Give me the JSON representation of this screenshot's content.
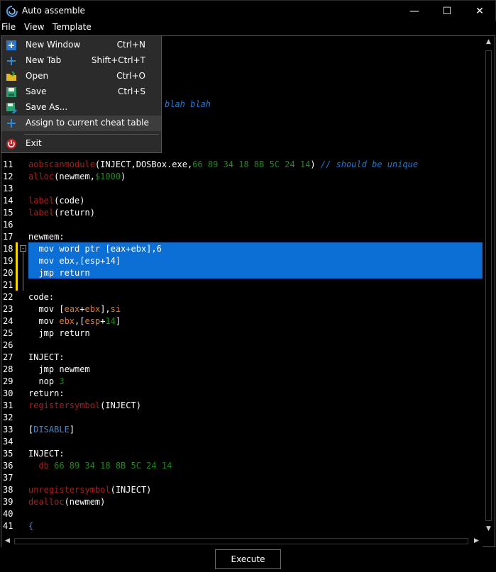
{
  "window": {
    "title": "Auto assemble",
    "min_glyph": "—",
    "max_glyph": "☐",
    "close_glyph": "✕"
  },
  "menubar": {
    "file": "File",
    "view": "View",
    "template": "Template"
  },
  "file_menu": {
    "new_window": {
      "label": "New Window",
      "shortcut": "Ctrl+N"
    },
    "new_tab": {
      "label": "New Tab",
      "shortcut": "Shift+Ctrl+T"
    },
    "open": {
      "label": "Open",
      "shortcut": "Ctrl+O"
    },
    "save": {
      "label": "Save",
      "shortcut": "Ctrl+S"
    },
    "save_as": {
      "label": "Save As..."
    },
    "assign": {
      "label": "Assign to current cheat table"
    },
    "exit": {
      "label": "Exit"
    }
  },
  "editor": {
    "partial_comment": "blah blah",
    "line_numbers": [
      "11",
      "12",
      "13",
      "14",
      "15",
      "16",
      "17",
      "18",
      "19",
      "20",
      "21",
      "22",
      "23",
      "24",
      "25",
      "26",
      "27",
      "28",
      "29",
      "30",
      "31",
      "32",
      "33",
      "34",
      "35",
      "36",
      "37",
      "38",
      "39",
      "40",
      "41"
    ],
    "code": {
      "l11_fn": "aobscanmodule",
      "l11_args_a": "(INJECT,DOSBox.exe,",
      "l11_bytes": "66 89 34 18 8B 5C 24 14",
      "l11_close": ")",
      "l11_comment": "// should be unique",
      "l12_fn": "alloc",
      "l12_args_a": "(newmem,",
      "l12_num": "$1000",
      "l12_close": ")",
      "l14_fn": "label",
      "l14_args": "(code)",
      "l15_fn": "label",
      "l15_args": "(return)",
      "l17": "newmem:",
      "l18": "  mov word ptr [eax+ebx],6",
      "l19": "  mov ebx,[esp+14]",
      "l20": "  jmp return",
      "l22": "code:",
      "l23_kw": "  mov ",
      "l23_a": "[",
      "l23_r1": "eax",
      "l23_p": "+",
      "l23_r2": "ebx",
      "l23_b": "],",
      "l23_r3": "si",
      "l24_kw": "  mov ",
      "l24_r1": "ebx",
      "l24_c": ",[",
      "l24_r2": "esp",
      "l24_p": "+",
      "l24_n": "14",
      "l24_b": "]",
      "l25": "  jmp return",
      "l27": "INJECT:",
      "l28": "  jmp newmem",
      "l29_kw": "  nop ",
      "l29_n": "3",
      "l30": "return:",
      "l31_fn": "registersymbol",
      "l31_args": "(INJECT)",
      "l33_a": "[",
      "l33_w": "DISABLE",
      "l33_b": "]",
      "l35": "INJECT:",
      "l36_kw": "  db ",
      "l36_bytes": "66 89 34 18 8B 5C 24 14",
      "l38_fn": "unregistersymbol",
      "l38_args": "(INJECT)",
      "l39_fn": "dealloc",
      "l39_args": "(newmem)",
      "l41": "{"
    }
  },
  "execute_button": "Execute",
  "colors": {
    "selection": "#0c6fd6",
    "keyword_red": "#b01c1c",
    "number_green": "#1e8a1e",
    "register_orange": "#e07a1f",
    "comment_blue": "#1e78d8"
  }
}
